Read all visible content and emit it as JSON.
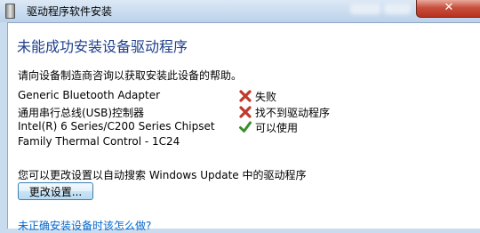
{
  "window": {
    "title": "驱动程序软件安装",
    "close_symbol": "✕"
  },
  "main": {
    "heading": "未能成功安装设备驱动程序",
    "help_text": "请向设备制造商咨询以获取安装此设备的帮助。",
    "devices": [
      {
        "name": "Generic Bluetooth Adapter",
        "status": "失败",
        "icon": "error-x-icon"
      },
      {
        "name": "通用串行总线(USB)控制器",
        "status": "找不到驱动程序",
        "icon": "error-x-icon"
      },
      {
        "name": "Intel(R) 6 Series/C200 Series Chipset",
        "status": "可以使用",
        "icon": "check-icon"
      }
    ],
    "device_name_continuation": "Family Thermal Control - 1C24",
    "update_message": "您可以更改设置以自动搜索 Windows Update 中的驱动程序",
    "change_settings_button": "更改设置...",
    "help_link": "未正确安装设备时该怎么做?"
  },
  "colors": {
    "heading": "#1e3f8c",
    "link": "#0066cc",
    "error": "#c0392b",
    "success": "#3a8f2a"
  }
}
